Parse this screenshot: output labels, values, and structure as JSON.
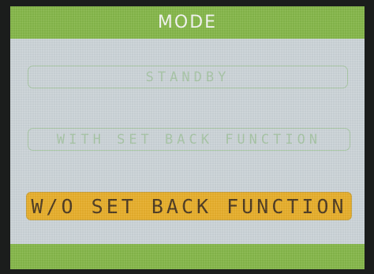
{
  "screen": {
    "title": "MODE",
    "options": [
      {
        "label": "STANDBY",
        "selected": false
      },
      {
        "label": "WITH SET BACK FUNCTION",
        "selected": false
      },
      {
        "label": "W/O SET BACK FUNCTION",
        "selected": true
      }
    ]
  },
  "colors": {
    "header_bar": "#86b84a",
    "background": "#cdd5d9",
    "selected_fill": "#e8af2c",
    "unselected_outline": "#a9c8a6"
  }
}
